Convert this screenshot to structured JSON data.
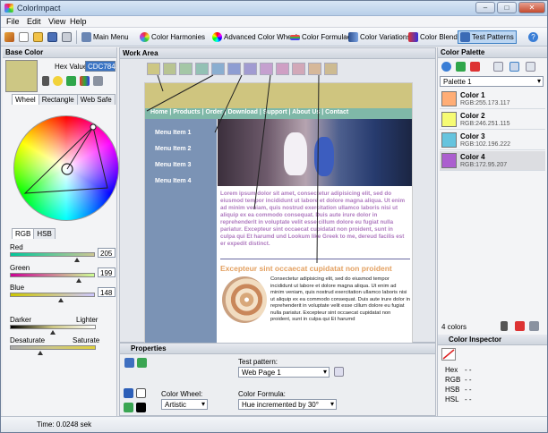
{
  "app": {
    "title": "ColorImpact"
  },
  "menu": {
    "items": [
      "File",
      "Edit",
      "View",
      "Help"
    ]
  },
  "toolbar": {
    "buttons": [
      "Main Menu",
      "Color Harmonies",
      "Advanced Color Wheel",
      "Color Formulae",
      "Color Variations",
      "Color Blender",
      "Test Patterns"
    ],
    "active": "Test Patterns"
  },
  "left_panel": {
    "title": "Base Color",
    "hex_label": "Hex Value:",
    "hex_value": "CDC784",
    "base_color": "#cdc784",
    "tabs": [
      "Wheel",
      "Rectangle",
      "Web Safe"
    ],
    "mode_tabs": [
      "RGB",
      "HSB"
    ],
    "sliders": [
      {
        "label": "Red",
        "value": "205"
      },
      {
        "label": "Green",
        "value": "199"
      },
      {
        "label": "Blue",
        "value": "148"
      }
    ],
    "darker_label": "Darker",
    "lighter_label": "Lighter",
    "desaturate_label": "Desaturate",
    "saturate_label": "Saturate"
  },
  "work_area": {
    "title": "Work Area",
    "palette_strip": [
      "#cdc784",
      "#b8c492",
      "#a4c7a6",
      "#93c1b4",
      "#8aaed0",
      "#8e9dd2",
      "#a19bd1",
      "#c5a0cf",
      "#cf9fc4",
      "#d2a8b8",
      "#d6b89a",
      "#cdbb92"
    ],
    "webpage": {
      "nav": [
        "Home",
        "Products",
        "Order",
        "Download",
        "Support",
        "About Us",
        "Contact"
      ],
      "menu_items": [
        "Menu Item 1",
        "Menu Item 2",
        "Menu Item 3",
        "Menu Item 4"
      ],
      "lorem": "Lorem ipsum dolor sit amet, consectetur adipisicing elit, sed do eiusmod tempor incididunt ut labore et dolore magna aliqua. Ut enim ad minim veniam, quis nostrud exercitation ullamco laboris nisi ut aliquip ex ea commodo consequat. Duis aute irure dolor in reprehenderit in voluptate velit esse cillum dolore eu fugiat nulla pariatur. Excepteur sint occaecat cupidatat non proident, sunt in culpa qui Et harumd und Lookum like Greek to me, dereud facilis est er expedit distinct.",
      "heading": "Excepteur sint occaecat cupidatat non proident",
      "small_text": "Consectetur adipisicing elit, sed do eiusmod tempor incididunt ut labore et dolore magna aliqua. Ut enim ad minim veniam, quis nostrud exercitation ullamco laboris nisi ut aliquip ex ea commodo consequat. Duis aute irure dolor in reprehenderit in voluptate velit esse cillum dolore eu fugiat nulla pariatur. Excepteur sint occaecat cupidatat non proident, sunt in culpa qui Et harumd"
    }
  },
  "properties": {
    "title": "Properties",
    "test_pattern_label": "Test pattern:",
    "test_pattern_value": "Web Page 1",
    "color_wheel_label": "Color Wheel:",
    "color_wheel_value": "Artistic",
    "color_formula_label": "Color Formula:",
    "color_formula_value": "Hue incremented by 30°"
  },
  "right_panel": {
    "title": "Color Palette",
    "palette_dropdown": "Palette 1",
    "colors": [
      {
        "name": "Color 1",
        "rgb": "RGB:255.173.117",
        "hex": "#ffad75"
      },
      {
        "name": "Color 2",
        "rgb": "RGB:246.251.115",
        "hex": "#f6fb73"
      },
      {
        "name": "Color 3",
        "rgb": "RGB:102.196.222",
        "hex": "#66c4de"
      },
      {
        "name": "Color 4",
        "rgb": "RGB:172.95.207",
        "hex": "#ac5fcf"
      }
    ],
    "count_text": "4 colors",
    "inspector_title": "Color Inspector",
    "inspector_rows": [
      {
        "label": "Hex",
        "value": "- -"
      },
      {
        "label": "RGB",
        "value": "- -"
      },
      {
        "label": "HSB",
        "value": "- -"
      },
      {
        "label": "HSL",
        "value": "- -"
      }
    ]
  },
  "status": {
    "time": "Time: 0.0248 sek"
  }
}
